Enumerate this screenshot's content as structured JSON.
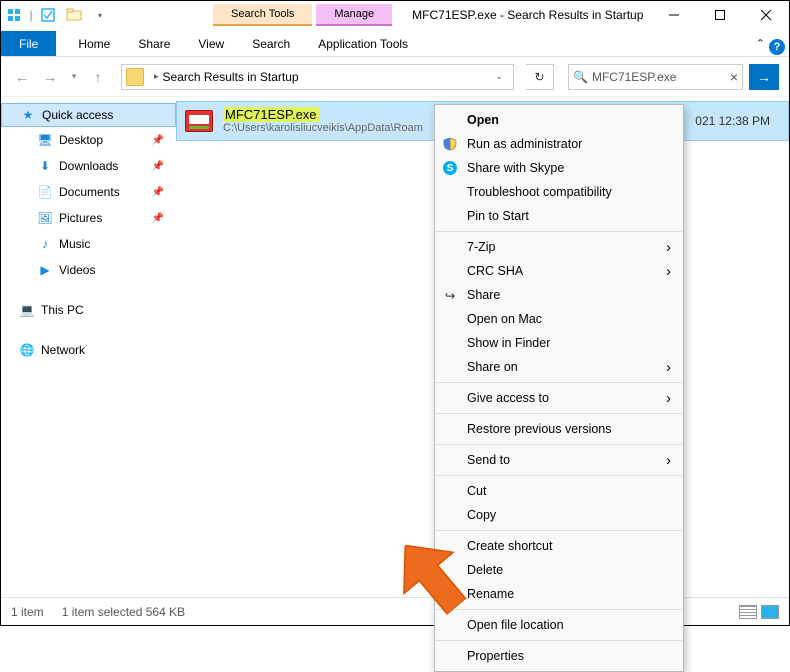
{
  "titlebar": {
    "context_tab_search": "Search Tools",
    "context_tab_manage": "Manage",
    "title": "MFC71ESP.exe - Search Results in Startup"
  },
  "ribbon": {
    "file": "File",
    "home": "Home",
    "share": "Share",
    "view": "View",
    "search": "Search",
    "app_tools": "Application Tools",
    "collapse_glyph": "ˆ",
    "help_glyph": "?"
  },
  "nav": {
    "back": "←",
    "forward": "→",
    "dropdown": "▾",
    "up": "↑",
    "refresh": "↻"
  },
  "breadcrumb": {
    "location": "Search Results in Startup"
  },
  "search": {
    "icon": "🔍",
    "query": "MFC71ESP.exe",
    "clear": "×",
    "go": "→"
  },
  "sidebar": {
    "quick_access": "Quick access",
    "desktop": "Desktop",
    "downloads": "Downloads",
    "documents": "Documents",
    "pictures": "Pictures",
    "music": "Music",
    "videos": "Videos",
    "this_pc": "This PC",
    "network": "Network"
  },
  "result": {
    "name": "MFC71ESP.exe",
    "path": "C:\\Users\\karolisliucveikis\\AppData\\Roam",
    "date_fragment": "021 12:38 PM"
  },
  "context_menu": {
    "open": "Open",
    "run_as_admin": "Run as administrator",
    "share_skype": "Share with Skype",
    "troubleshoot": "Troubleshoot compatibility",
    "pin_start": "Pin to Start",
    "seven_zip": "7-Zip",
    "crc_sha": "CRC SHA",
    "share": "Share",
    "open_on_mac": "Open on Mac",
    "show_in_finder": "Show in Finder",
    "share_on": "Share on",
    "give_access": "Give access to",
    "restore": "Restore previous versions",
    "send_to": "Send to",
    "cut": "Cut",
    "copy": "Copy",
    "create_shortcut": "Create shortcut",
    "delete": "Delete",
    "rename": "Rename",
    "open_file_location": "Open file location",
    "properties": "Properties"
  },
  "statusbar": {
    "count": "1 item",
    "selection": "1 item selected  564 KB"
  }
}
